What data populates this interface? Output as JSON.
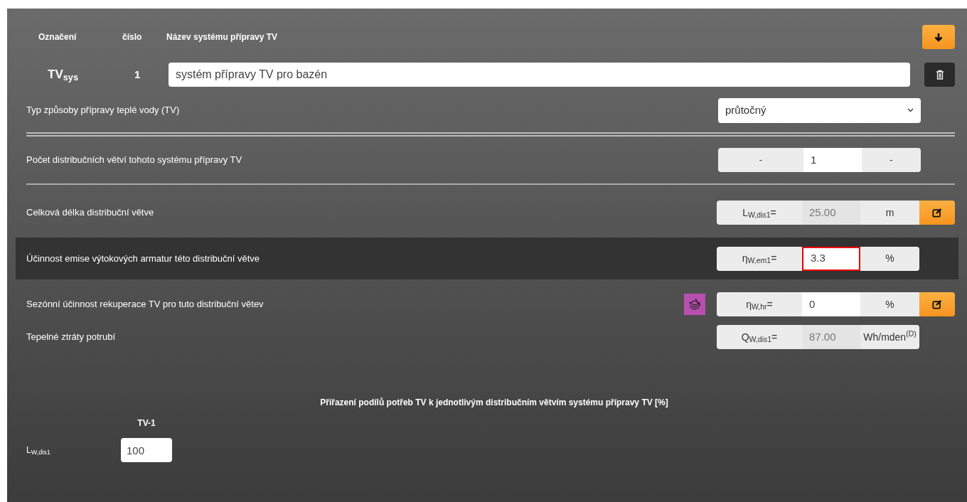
{
  "header": {
    "columns": [
      "Označení",
      "číslo",
      "Název systému přípravy TV"
    ]
  },
  "system": {
    "symbol": "TV$_{sys}$",
    "number": "1",
    "name": "systém přípravy TV pro bazén"
  },
  "type_row": {
    "label": "Typ způsoby přípravy teplé vody (TV)",
    "value": "průtočný"
  },
  "count_row": {
    "label": "Počet distribučních větví tohoto systému přípravy TV",
    "decrement": "-",
    "value": "1",
    "increment": "-"
  },
  "params": [
    {
      "label": "Celková délka distribuční větve",
      "symbol": "L$_{W,dis1}$=",
      "value": "25.00",
      "unit": "m",
      "editable": false,
      "highlighted": false,
      "error": false,
      "edit_button": true,
      "catalog_icon": false
    },
    {
      "label": "Účinnost emise výtokových armatur této distribuční větve",
      "symbol": "η$_{W,em1}$=",
      "value": "3.3",
      "unit": "%",
      "editable": true,
      "highlighted": true,
      "error": true,
      "edit_button": false,
      "catalog_icon": false
    },
    {
      "label": "Sezónní účinnost rekuperace TV pro tuto distribuční větev",
      "symbol": "η$_{W,hr}$=",
      "value": "0",
      "unit": "%",
      "editable": true,
      "highlighted": false,
      "error": false,
      "edit_button": true,
      "catalog_icon": true
    },
    {
      "label": "Tepelné ztráty potrubí",
      "symbol": "Q$_{W,dis1}$=",
      "value": "87.00",
      "unit": "Wh/mden$^{(D)}$",
      "editable": false,
      "highlighted": false,
      "error": false,
      "edit_button": false,
      "catalog_icon": false
    }
  ],
  "shares": {
    "title": "Přiřazení podílů potřeb TV k jednotlivým distribučním větvím systému přípravy TV [%]",
    "columns": [
      "TV-1"
    ],
    "rows": [
      {
        "label": "L$_{W,dis1}$",
        "values": [
          "100"
        ]
      }
    ]
  }
}
